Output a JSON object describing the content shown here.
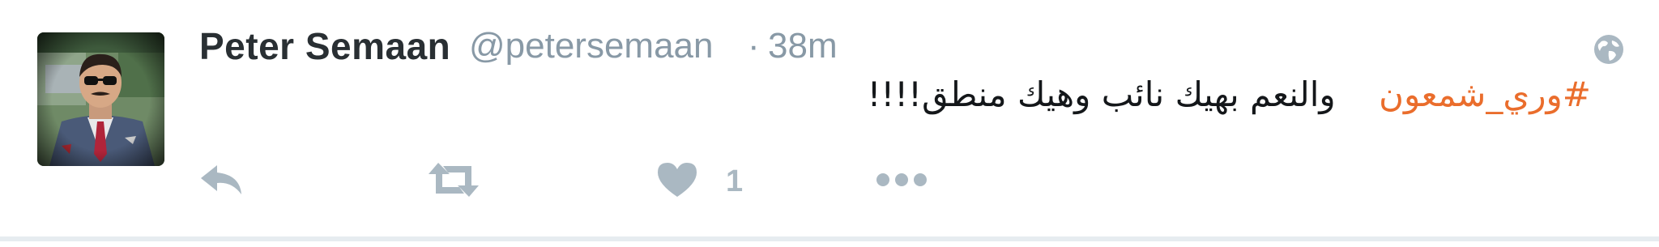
{
  "tweet": {
    "display_name": "Peter Semaan",
    "handle": "@petersemaan",
    "separator": "·",
    "time": "38m",
    "hashtag": "#وري_شمعون",
    "body_text": "والنعم بهيك نائب وهيك منطق!!!!",
    "like_count": "1"
  },
  "icons": {
    "reply": "reply-icon",
    "retweet": "retweet-icon",
    "like": "heart-icon",
    "more": "more-dots-icon",
    "globe": "globe-icon"
  },
  "colors": {
    "hashtag": "#ea6d2c",
    "action_icon": "#aab8c2",
    "handle": "#8899a6",
    "name": "#292f33"
  }
}
